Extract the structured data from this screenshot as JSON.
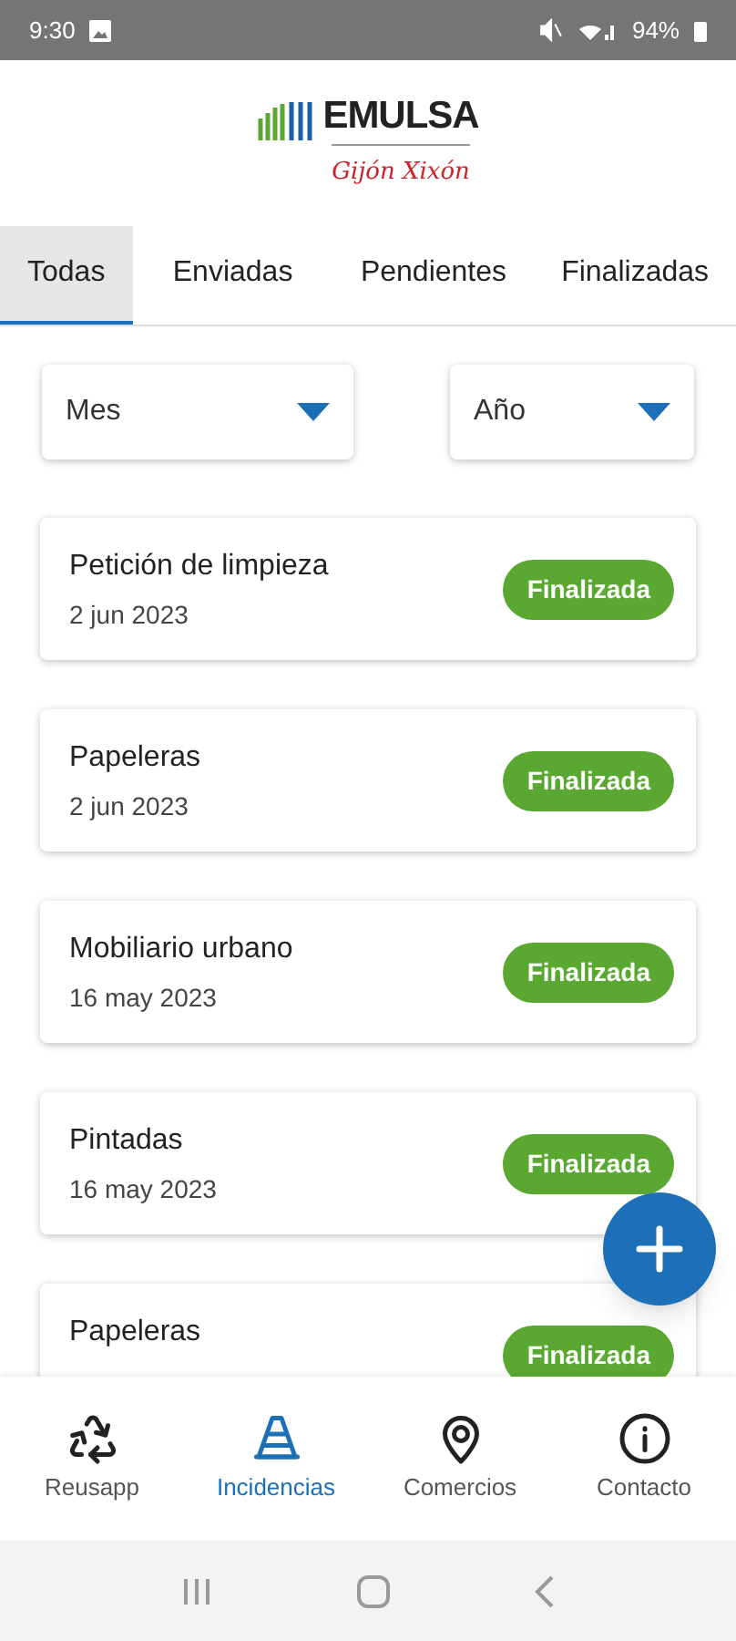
{
  "status_bar": {
    "time": "9:30",
    "battery": "94%"
  },
  "logo": {
    "name": "EMULSA",
    "city": "Gijón Xixón"
  },
  "tabs": [
    {
      "label": "Todas",
      "selected": true
    },
    {
      "label": "Enviadas",
      "selected": false
    },
    {
      "label": "Pendientes",
      "selected": false
    },
    {
      "label": "Finalizadas",
      "selected": false
    }
  ],
  "filters": [
    {
      "label": "Mes"
    },
    {
      "label": "Año"
    }
  ],
  "incidents": [
    {
      "title": "Petición de limpieza",
      "date": "2 jun 2023",
      "status": "Finalizada"
    },
    {
      "title": "Papeleras",
      "date": "2 jun 2023",
      "status": "Finalizada"
    },
    {
      "title": "Mobiliario urbano",
      "date": "16 may 2023",
      "status": "Finalizada"
    },
    {
      "title": "Pintadas",
      "date": "16 may 2023",
      "status": "Finalizada"
    },
    {
      "title": "Papeleras",
      "status": "Finalizada"
    }
  ],
  "bottom_nav": [
    {
      "label": "Reusapp",
      "kind": "recycle",
      "selected": false
    },
    {
      "label": "Incidencias",
      "kind": "cone",
      "selected": true
    },
    {
      "label": "Comercios",
      "kind": "pin",
      "selected": false
    },
    {
      "label": "Contacto",
      "kind": "info",
      "selected": false
    }
  ]
}
